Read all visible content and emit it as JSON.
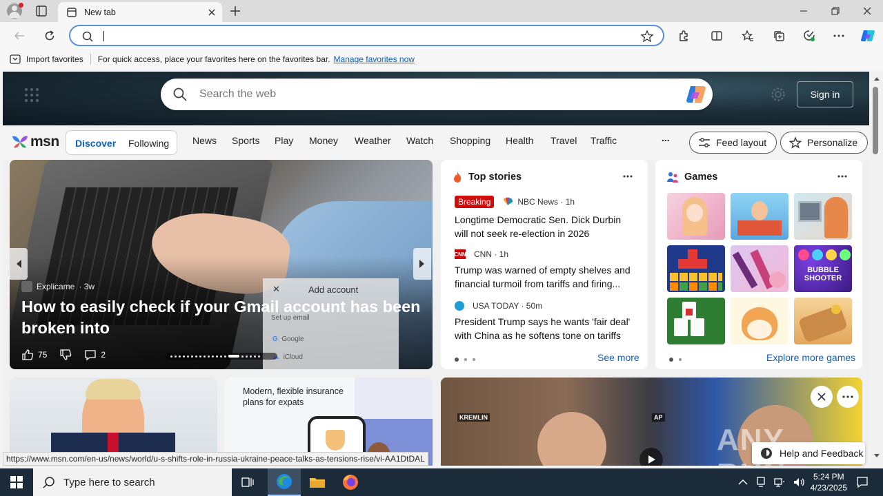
{
  "browser": {
    "tab_title": "New tab",
    "address_value": "",
    "favorites_bar": {
      "import_label": "Import favorites",
      "message": "For quick access, place your favorites here on the favorites bar.",
      "manage_link": "Manage favorites now"
    }
  },
  "msn": {
    "search_placeholder": "Search the web",
    "sign_in": "Sign in",
    "logo": "msn",
    "feed_tabs": [
      "Discover",
      "Following"
    ],
    "nav": [
      "News",
      "Sports",
      "Play",
      "Money",
      "Weather",
      "Watch",
      "Shopping",
      "Health",
      "Travel",
      "Traffic"
    ],
    "more": "...",
    "feed_layout": "Feed layout",
    "personalize": "Personalize",
    "hero": {
      "source": "Explicame",
      "age": "· 3w",
      "title": "How to easily check if your Gmail account has been broken into",
      "likes": "75",
      "comments": "2",
      "dialog_title": "Add account",
      "dialog_sub": "Set up email",
      "dialog_opt1": "Google",
      "dialog_opt2": "iCloud"
    },
    "top_stories": {
      "title": "Top stories",
      "items": [
        {
          "badge": "Breaking",
          "source": "NBC News · 1h",
          "title": "Longtime Democratic Sen. Dick Durbin will not seek re-election in 2026"
        },
        {
          "source": "CNN · 1h",
          "title": "Trump was warned of empty shelves and financial turmoil from tariffs and firing..."
        },
        {
          "source": "USA TODAY · 50m",
          "title": "President Trump says he wants 'fair deal' with China as he softens tone on tariffs"
        }
      ],
      "see_more": "See more"
    },
    "games": {
      "title": "Games",
      "explore": "Explore more games",
      "bubble_label": "BUBBLE SHOOTER"
    },
    "row2": {
      "insurance_text": "Modern, flexible insurance plans for expats",
      "kremlin_tag": "KREMLIN",
      "ap_tag": "AP"
    },
    "help_feedback": "Help and Feedback"
  },
  "status_url": "https://www.msn.com/en-us/news/world/u-s-shifts-role-in-russia-ukraine-peace-talks-as-tensions-rise/vi-AA1DtDAL",
  "watermark": "ANY RUN",
  "taskbar": {
    "search_placeholder": "Type here to search",
    "time": "5:24 PM",
    "date": "4/23/2025"
  },
  "colors": {
    "accent": "#0f5fbf",
    "breaking": "#d10c0c",
    "taskbar": "#1c2b3a"
  }
}
